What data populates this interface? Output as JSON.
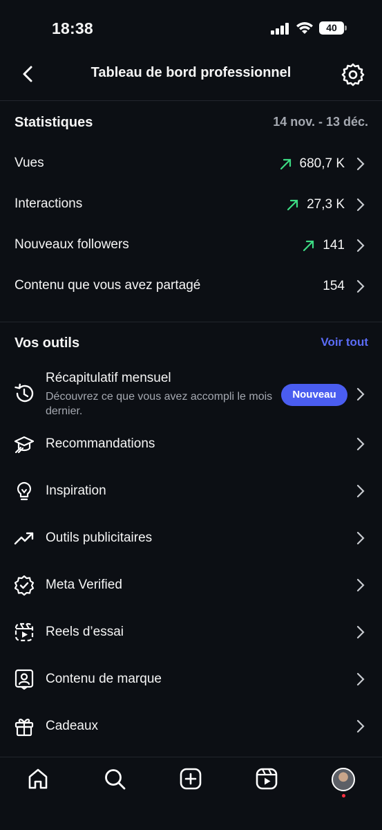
{
  "status_bar": {
    "time": "18:38",
    "battery": "40"
  },
  "header": {
    "title": "Tableau de bord professionnel"
  },
  "stats": {
    "title": "Statistiques",
    "date_range": "14 nov. - 13 déc.",
    "rows": [
      {
        "label": "Vues",
        "value": "680,7 K",
        "trend": "up"
      },
      {
        "label": "Interactions",
        "value": "27,3 K",
        "trend": "up"
      },
      {
        "label": "Nouveaux followers",
        "value": "141",
        "trend": "up"
      },
      {
        "label": "Contenu que vous avez partagé",
        "value": "154",
        "trend": "none"
      }
    ]
  },
  "tools": {
    "title": "Vos outils",
    "see_all": "Voir tout",
    "recap": {
      "title": "Récapitulatif mensuel",
      "description": "Découvrez ce que vous avez accompli le mois dernier.",
      "badge": "Nouveau",
      "icon": "history-icon"
    },
    "items": [
      {
        "label": "Recommandations",
        "icon": "graduation-cap-icon"
      },
      {
        "label": "Inspiration",
        "icon": "lightbulb-icon"
      },
      {
        "label": "Outils publicitaires",
        "icon": "trending-up-icon"
      },
      {
        "label": "Meta Verified",
        "icon": "verified-badge-icon"
      },
      {
        "label": "Reels d’essai",
        "icon": "trial-reel-icon"
      },
      {
        "label": "Contenu de marque",
        "icon": "branded-content-icon"
      },
      {
        "label": "Cadeaux",
        "icon": "gift-icon"
      }
    ]
  },
  "colors": {
    "background": "#0c0f14",
    "accent": "#4a5df0",
    "link": "#5b6cf6",
    "trend_up": "#3ddc84",
    "muted": "#a5a9b1"
  },
  "bottom_nav": [
    "home-icon",
    "search-icon",
    "create-icon",
    "reels-icon",
    "profile-avatar"
  ]
}
